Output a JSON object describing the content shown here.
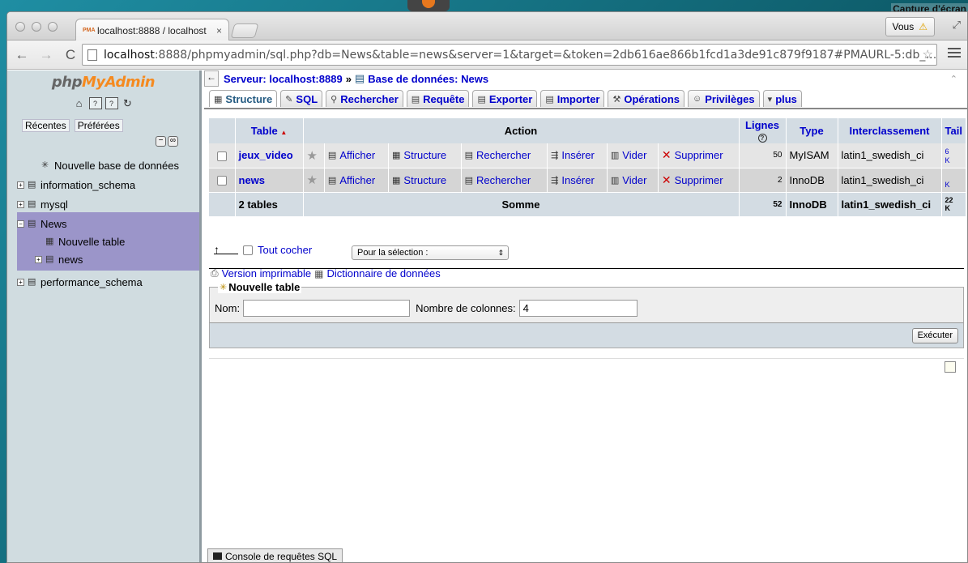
{
  "desktop": {
    "label": "Capture d'écran"
  },
  "browser": {
    "tab_title": "localhost:8888 / localhost",
    "tab_favicon": "PMA",
    "tab_close": "×",
    "user_button": "Vous",
    "url_host": "localhost",
    "url_rest": ":8888/phpmyadmin/sql.php?db=News&table=news&server=1&target=&token=2db616ae866b1fcd1a3de91c879f9187#PMAURL-5:db_…",
    "back_glyph": "←",
    "forward_glyph": "→",
    "reload_glyph": "C",
    "star_glyph": "☆"
  },
  "sidebar": {
    "logo_php": "php",
    "logo_myadmin": "MyAdmin",
    "tabs": [
      "Récentes",
      "Préférées"
    ],
    "tree": [
      {
        "label": "Nouvelle base de données"
      },
      {
        "label": "information_schema"
      },
      {
        "label": "mysql"
      },
      {
        "label": "News"
      },
      {
        "label": "Nouvelle table"
      },
      {
        "label": "news"
      },
      {
        "label": "performance_schema"
      }
    ]
  },
  "breadcrumb": {
    "server": "Serveur: localhost:8889",
    "separator": "»",
    "database": "Base de données: News"
  },
  "menu": [
    {
      "label": "Structure",
      "icon": "structure-icon"
    },
    {
      "label": "SQL",
      "icon": "sql-icon"
    },
    {
      "label": "Rechercher",
      "icon": "search-icon"
    },
    {
      "label": "Requête",
      "icon": "query-icon"
    },
    {
      "label": "Exporter",
      "icon": "export-icon"
    },
    {
      "label": "Importer",
      "icon": "import-icon"
    },
    {
      "label": "Opérations",
      "icon": "operations-icon"
    },
    {
      "label": "Privilèges",
      "icon": "privileges-icon"
    },
    {
      "label": "plus",
      "icon": "chevron-down-icon"
    }
  ],
  "table": {
    "headers": {
      "table": "Table",
      "action": "Action",
      "rows": "Lignes",
      "type": "Type",
      "collation": "Interclassement",
      "size": "Tail"
    },
    "actions": {
      "browse": "Afficher",
      "structure": "Structure",
      "search": "Rechercher",
      "insert": "Insérer",
      "empty": "Vider",
      "drop": "Supprimer"
    },
    "rows": [
      {
        "name": "jeux_video",
        "rows": "50",
        "type": "MyISAM",
        "collation": "latin1_swedish_ci",
        "size": "6",
        "size_unit": "K"
      },
      {
        "name": "news",
        "rows": "2",
        "type": "InnoDB",
        "collation": "latin1_swedish_ci",
        "size": "",
        "size_unit": "K"
      }
    ],
    "footer": {
      "count": "2 tables",
      "sum_label": "Somme",
      "rows": "52",
      "type": "InnoDB",
      "collation": "latin1_swedish_ci",
      "size": "22",
      "size_unit": "K"
    }
  },
  "bulk": {
    "check_all": "Tout cocher",
    "select_label": "Pour la sélection :"
  },
  "links": {
    "print": "Version imprimable",
    "dictionary": "Dictionnaire de données"
  },
  "new_table": {
    "legend": "Nouvelle table",
    "name_label": "Nom:",
    "name_value": "",
    "columns_label": "Nombre de colonnes:",
    "columns_value": "4",
    "submit": "Exécuter"
  },
  "console": {
    "label": "Console de requêtes SQL"
  }
}
